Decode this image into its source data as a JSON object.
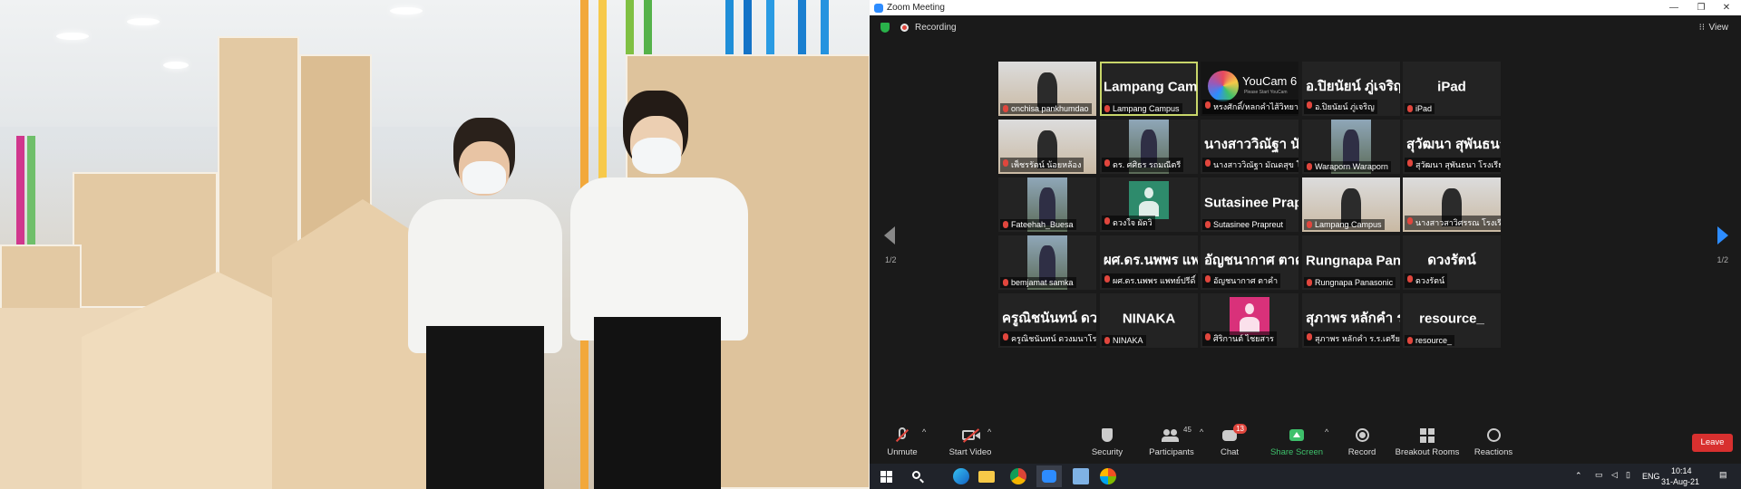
{
  "window": {
    "title": "Zoom Meeting"
  },
  "meeting": {
    "recording_label": "Recording",
    "view_label": "View"
  },
  "pagination": {
    "left": "1/2",
    "right": "1/2"
  },
  "tiles": [
    {
      "name": "",
      "label": "onchisa pankhumdao",
      "kind": "video"
    },
    {
      "name": "Lampang Campus",
      "label": "Lampang Campus",
      "kind": "name",
      "active": true
    },
    {
      "name": "",
      "label": "หรงศักดิ์/หลกคำไส้วิทยาคม",
      "kind": "youcam",
      "youcam_text": "YouCam 6",
      "youcam_sub": "Please Start YouCam"
    },
    {
      "name": "อ.ปิยนัยน์ ภู่เจริญ",
      "label": "อ.ปิยนัยน์ ภู่เจริญ",
      "kind": "name"
    },
    {
      "name": "iPad",
      "label": "iPad",
      "kind": "name"
    },
    {
      "name": "",
      "label": "เพ็ชรรัตน์ น้อยหล้อง",
      "kind": "video"
    },
    {
      "name": "",
      "label": "ดร. ศศิธร รถมณีตรี",
      "kind": "photo"
    },
    {
      "name": "นางสาววิณัฐา นั...",
      "label": "นางสาววิณัฐา มัณดสุข โรงเรี...",
      "kind": "name"
    },
    {
      "name": "",
      "label": "Waraporn Waraporn",
      "kind": "photo"
    },
    {
      "name": "สุวัฒนา สุพันธนา...",
      "label": "สุวัฒนา สุพันธนา โรงเรียนพิบู...",
      "kind": "name"
    },
    {
      "name": "",
      "label": "Fateehah_Buesa",
      "kind": "photo"
    },
    {
      "name": "",
      "label": "ดวงใจ ผัดวิ",
      "kind": "avatar",
      "avatar_color": "#2e8b6c"
    },
    {
      "name": "Sutasinee  Prapr...",
      "label": "Sutasinee Prapreut",
      "kind": "name"
    },
    {
      "name": "",
      "label": "Lampang Campus",
      "kind": "video"
    },
    {
      "name": "",
      "label": "นางสาวสาวิศรรณ โรงเรียนดาร...",
      "kind": "video"
    },
    {
      "name": "",
      "label": "bemjamat samka",
      "kind": "photo"
    },
    {
      "name": "ผศ.ดร.นพพร แพ...",
      "label": "ผศ.ดร.นพพร แพทย์ปรีดิ์",
      "kind": "name"
    },
    {
      "name": "อัญชนากาศ  ตาคำ",
      "label": "อัญชนากาศ ตาคำ",
      "kind": "name"
    },
    {
      "name": "Rungnapa  Pana...",
      "label": "Rungnapa Panasonic",
      "kind": "name"
    },
    {
      "name": "ดวงรัตน์",
      "label": "ดวงรัตน์",
      "kind": "name"
    },
    {
      "name": "ครูณิชนันทน์ ดวง...",
      "label": "ครูณิชนันทน์ ดวงมนาโรงเรีย...",
      "kind": "name"
    },
    {
      "name": "NINAKA",
      "label": "NINAKA",
      "kind": "name"
    },
    {
      "name": "",
      "label": "ศิริกานต์ ไชยสาร",
      "kind": "avatar",
      "avatar_color": "#d9317a"
    },
    {
      "name": "สุภาพร หลักคำ ร....",
      "label": "สุภาพร หลักคำ ร.ร.เตรียมอุดม...",
      "kind": "name"
    },
    {
      "name": "resource_",
      "label": "resource_",
      "kind": "name"
    }
  ],
  "toolbar": {
    "unmute": "Unmute",
    "start_video": "Start Video",
    "security": "Security",
    "participants": "Participants",
    "participants_count": "45",
    "chat": "Chat",
    "chat_badge": "13",
    "share_screen": "Share Screen",
    "record": "Record",
    "breakout": "Breakout Rooms",
    "reactions": "Reactions",
    "leave": "Leave"
  },
  "taskbar": {
    "lang": "ENG",
    "time": "10:14",
    "date": "31-Aug-21"
  },
  "colors": {
    "zoom_bg": "#1a1a1a",
    "tile_bg": "#232323",
    "active_border": "#c8d66a",
    "leave_red": "#d8302f",
    "share_green": "#3ec06b",
    "zoom_blue": "#2d8cff"
  }
}
